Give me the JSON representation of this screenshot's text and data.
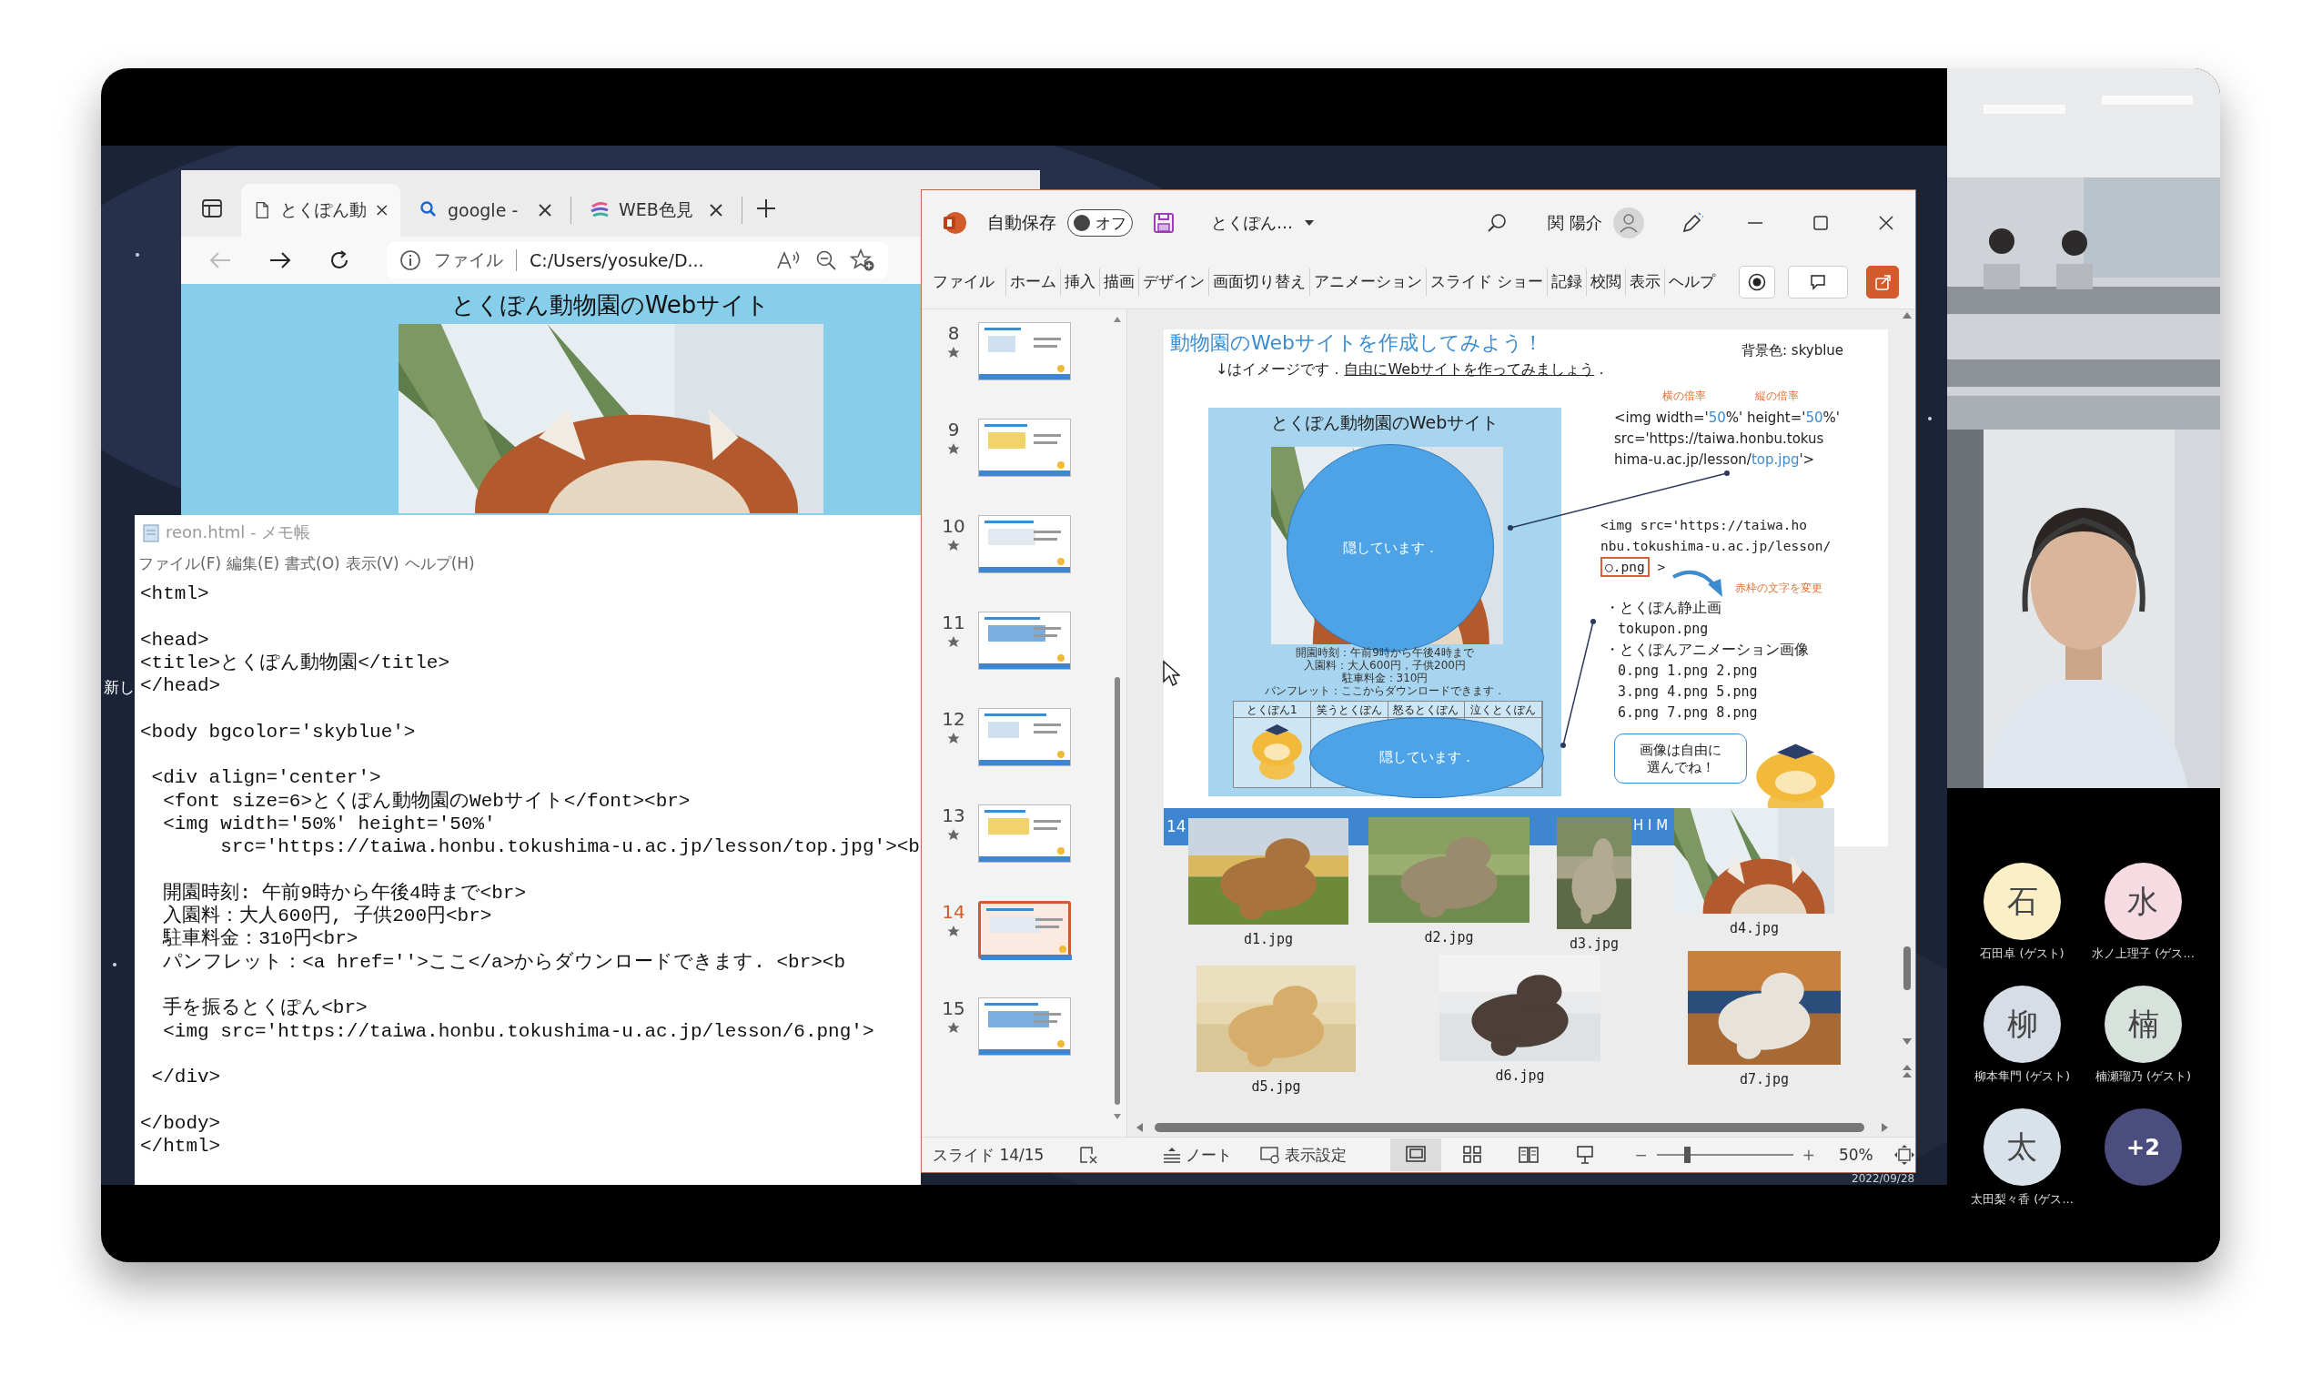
{
  "desktop": {
    "icon_label": "新し",
    "clock_date": "2022/09/28"
  },
  "browser": {
    "tabs": [
      {
        "kind": "page",
        "title": "とくぽん動",
        "selected": true
      },
      {
        "kind": "search",
        "title": "google -",
        "selected": false
      },
      {
        "kind": "site",
        "title": "WEB色見",
        "selected": false
      }
    ],
    "back_button": {
      "disabled": true
    },
    "address": {
      "scheme": "ファイル",
      "url": "C:/Users/yosuke/D..."
    },
    "page": {
      "heading": "とくぽん動物園のWebサイト"
    }
  },
  "notepad": {
    "title": "reon.html - メモ帳",
    "menu": [
      "ファイル(F)",
      "編集(E)",
      "書式(O)",
      "表示(V)",
      "ヘルプ(H)"
    ],
    "text": "<html>\n\n<head>\n<title>とくぽん動物園</title>\n</head>\n\n<body bgcolor='skyblue'>\n\n <div align='center'>\n  <font size=6>とくぽん動物園のWebサイト</font><br>\n  <img width='50%' height='50%'\n       src='https://taiwa.honbu.tokushima-u.ac.jp/lesson/top.jpg'><b\n\n  開園時刻: 午前9時から午後4時まで<br>\n  入園料：大人600円, 子供200円<br>\n  駐車料金：310円<br>\n  パンフレット：<a href=''>ここ</a>からダウンロードできます. <br><b\n\n  手を振るとくぽん<br>\n  <img src='https://taiwa.honbu.tokushima-u.ac.jp/lesson/6.png'>\n\n </div>\n\n</body>\n</html>"
  },
  "powerpoint": {
    "title_bar": {
      "autosave_label": "自動保存",
      "autosave": {
        "label": "オフ",
        "on": false
      },
      "file_name": "とくぽん…",
      "user_name": "関 陽介"
    },
    "ribbon_tabs": [
      "ファイル",
      "ホーム",
      "挿入",
      "描画",
      "デザイン",
      "画面切り替え",
      "アニメーション",
      "スライド ショー",
      "記録",
      "校閲",
      "表示",
      "ヘルプ"
    ],
    "thumbnails": [
      {
        "number": "8",
        "selected": false
      },
      {
        "number": "9",
        "selected": false
      },
      {
        "number": "10",
        "selected": false
      },
      {
        "number": "11",
        "selected": false
      },
      {
        "number": "12",
        "selected": false
      },
      {
        "number": "13",
        "selected": false
      },
      {
        "number": "14",
        "selected": true
      },
      {
        "number": "15",
        "selected": false
      }
    ],
    "slide": {
      "title": "動物園のWebサイトを作成してみよう！",
      "background_note": "背景色: skyblue",
      "subtitle": [
        {
          "text": "↓はイメージです．",
          "underline": false
        },
        {
          "text": "自由にWebサイトを作ってみましょう",
          "underline": true
        },
        {
          "text": "．",
          "underline": false
        }
      ],
      "mock": {
        "title": "とくぽん動物園のWebサイト",
        "covers": [
          "隠しています．",
          "隠しています．"
        ],
        "info_lines": [
          "開園時刻：午前9時から午後4時まで",
          "入園料：大人600円，子供200円",
          "駐車料金：310円",
          "パンフレット：ここからダウンロードできます．"
        ],
        "table_headers": [
          "とくぽん1",
          "笑うとくぽん",
          "怒るとくぽん",
          "泣くとくぽん"
        ]
      },
      "width_label": "横の倍率",
      "height_label": "縦の倍率",
      "code_top": [
        [
          {
            "text": "<img width='",
            "highlight": false
          },
          {
            "text": "50",
            "highlight": true
          },
          {
            "text": "%' height='",
            "highlight": false
          },
          {
            "text": "50",
            "highlight": true
          },
          {
            "text": "%'",
            "highlight": false
          }
        ],
        [
          {
            "text": "src='https://taiwa.honbu.tokus",
            "highlight": false
          }
        ],
        [
          {
            "text": "hima-u.ac.jp/lesson/",
            "highlight": false
          },
          {
            "text": "top.jpg",
            "highlight": true
          },
          {
            "text": "'>",
            "highlight": false
          }
        ]
      ],
      "code_bottom": [
        [
          {
            "text": "<img src='https://taiwa.ho",
            "boxed": false
          }
        ],
        [
          {
            "text": "nbu.tokushima-u.ac.jp/lesson/",
            "boxed": false
          }
        ],
        [
          {
            "text": "○.png",
            "boxed": true
          },
          {
            "text": " >",
            "boxed": false
          }
        ]
      ],
      "change_note": "赤枠の文字を変更",
      "bullets": [
        {
          "kind": "heading",
          "text": "・とくぽん静止画"
        },
        {
          "kind": "detail",
          "text": "tokupon.png"
        },
        {
          "kind": "heading",
          "text": "・とくぽんアニメーション画像"
        },
        {
          "kind": "detail",
          "text": "0.png 1.png 2.png"
        },
        {
          "kind": "detail",
          "text": "3.png 4.png 5.png"
        },
        {
          "kind": "detail",
          "text": "6.png 7.png 8.png"
        }
      ],
      "bubble": [
        "画像は自由に",
        "選んでね！"
      ],
      "band": [
        "14",
        "H I M"
      ],
      "photos": [
        {
          "label": "d1.jpg"
        },
        {
          "label": "d2.jpg"
        },
        {
          "label": "d3.jpg"
        },
        {
          "label": "d4.jpg"
        },
        {
          "label": "d5.jpg"
        },
        {
          "label": "d6.jpg"
        },
        {
          "label": "d7.jpg"
        }
      ]
    },
    "status_bar": {
      "slide_indicator": "スライド 14/15",
      "notes": "ノート",
      "display_settings": "表示設定",
      "views": [
        {
          "kind": "normal",
          "selected": true
        },
        {
          "kind": "sorter",
          "selected": false
        },
        {
          "kind": "reading",
          "selected": false
        },
        {
          "kind": "slideshow",
          "selected": false
        }
      ],
      "zoom": {
        "minus": "−",
        "level": 0.22,
        "plus": "+",
        "reading": "50%"
      }
    }
  },
  "participants": [
    {
      "kind": "person",
      "initial": "石",
      "name": "石田卓 (ゲスト)",
      "color": "#fbefc7"
    },
    {
      "kind": "person",
      "initial": "水",
      "name": "水ノ上理子 (ゲス...",
      "color": "#f7dbe3"
    },
    {
      "kind": "person",
      "initial": "柳",
      "name": "柳本隼門 (ゲスト)",
      "color": "#d6dde6"
    },
    {
      "kind": "person",
      "initial": "楠",
      "name": "楠瀬瑠乃 (ゲスト)",
      "color": "#d6e2db"
    },
    {
      "kind": "person",
      "initial": "太",
      "name": "太田梨々香 (ゲス...",
      "color": "#d9e2eb"
    },
    {
      "kind": "more",
      "initial": "+2",
      "color": "#4b4d7e"
    }
  ]
}
